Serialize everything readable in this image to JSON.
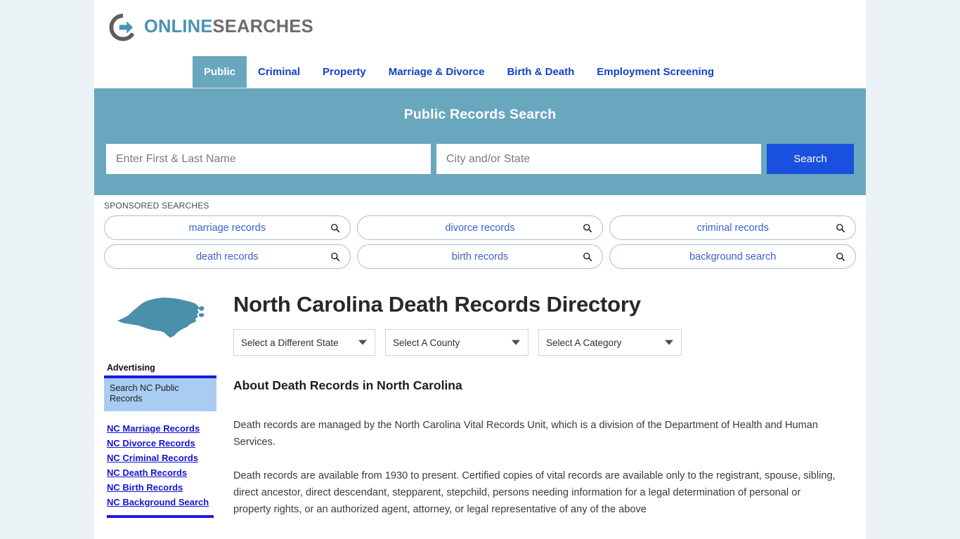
{
  "site": {
    "logo_primary": "ONLINE",
    "logo_secondary": "SEARCHES",
    "brand_blue": "#4a93b5",
    "brand_gray": "#6d6d6d"
  },
  "nav": {
    "items": [
      {
        "label": "Public",
        "active": true
      },
      {
        "label": "Criminal",
        "active": false
      },
      {
        "label": "Property",
        "active": false
      },
      {
        "label": "Marriage & Divorce",
        "active": false
      },
      {
        "label": "Birth & Death",
        "active": false
      },
      {
        "label": "Employment Screening",
        "active": false
      }
    ]
  },
  "hero": {
    "title": "Public Records Search",
    "name_placeholder": "Enter First & Last Name",
    "name_value": "",
    "location_placeholder": "City and/or State",
    "location_value": "",
    "search_button": "Search",
    "background_color": "#69a7be",
    "button_color": "#1a50e0"
  },
  "sponsored": {
    "label": "SPONSORED SEARCHES",
    "chips": [
      {
        "label": "marriage records",
        "icon": "search-icon"
      },
      {
        "label": "divorce records",
        "icon": "search-icon"
      },
      {
        "label": "criminal records",
        "icon": "search-icon"
      },
      {
        "label": "death records",
        "icon": "search-icon"
      },
      {
        "label": "birth records",
        "icon": "search-icon"
      },
      {
        "label": "background search",
        "icon": "search-icon"
      }
    ]
  },
  "main": {
    "state_map_name": "north-carolina-map",
    "title": "North Carolina Death Records Directory",
    "selects": [
      {
        "id": "state",
        "value": "Select a Different State"
      },
      {
        "id": "county",
        "value": "Select A County"
      },
      {
        "id": "category",
        "value": "Select A Category"
      }
    ],
    "section_heading": "About Death Records in North Carolina",
    "paragraphs": [
      "Death records are managed by the North Carolina Vital Records Unit, which is a division of the Department of Health and Human Services.",
      "Death records are available from 1930 to present. Certified copies of vital records are available only to the registrant, spouse, sibling, direct ancestor, direct descendant, stepparent, stepchild, persons needing information for a legal determination of personal or property rights, or an authorized agent, attorney, or legal representative of any of the above"
    ]
  },
  "sidebar": {
    "advertising_label": "Advertising",
    "ad_text": "Search NC Public Records",
    "ad_background": "#a9cdf2",
    "links": [
      "NC Marriage Records",
      "NC Divorce Records",
      "NC Criminal Records",
      "NC Death Records",
      "NC Birth Records",
      "NC Background Search"
    ]
  }
}
